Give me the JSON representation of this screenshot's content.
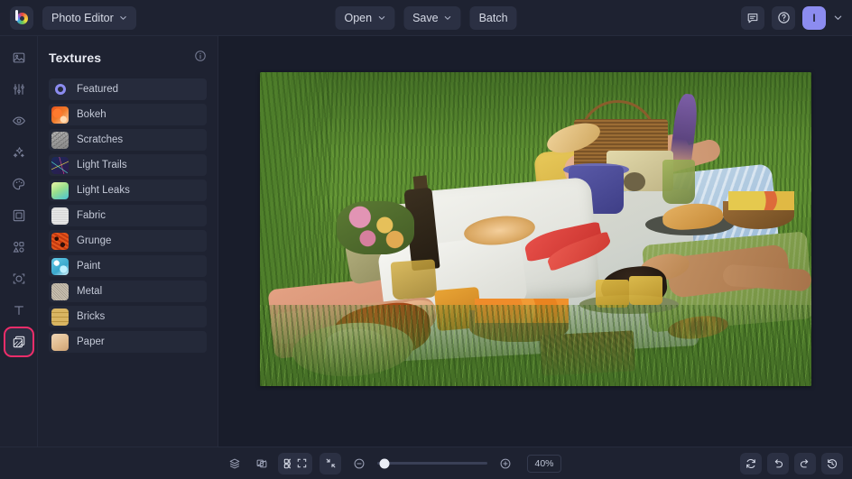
{
  "app": {
    "logo_icon": "pixlr-logo-icon",
    "project_menu": "Photo Editor",
    "project_menu_chevron": "chevron-down-icon"
  },
  "topbar": {
    "open_label": "Open",
    "save_label": "Save",
    "batch_label": "Batch",
    "open_chevron": "chevron-down-icon",
    "save_chevron": "chevron-down-icon",
    "feedback_icon": "comment-icon",
    "help_icon": "question-circle-icon",
    "avatar_initial": "I",
    "avatar_chevron": "chevron-down-icon",
    "avatar_color": "#8c8cf0"
  },
  "toolrail": {
    "items": [
      {
        "name": "tool-image",
        "icon": "image-icon",
        "active": false
      },
      {
        "name": "tool-adjust",
        "icon": "sliders-icon",
        "active": false
      },
      {
        "name": "tool-retouch",
        "icon": "eye-icon",
        "active": false
      },
      {
        "name": "tool-effects",
        "icon": "sparkles-icon",
        "active": false
      },
      {
        "name": "tool-color",
        "icon": "palette-icon",
        "active": false
      },
      {
        "name": "tool-frame",
        "icon": "frame-icon",
        "active": false
      },
      {
        "name": "tool-elements",
        "icon": "shapes-icon",
        "active": false
      },
      {
        "name": "tool-cutout",
        "icon": "cutout-icon",
        "active": false
      },
      {
        "name": "tool-text",
        "icon": "text-t-icon",
        "active": false
      },
      {
        "name": "tool-textures",
        "icon": "layers-stack-icon",
        "active": true
      }
    ],
    "active_highlight_color": "#ef2d6a"
  },
  "panel": {
    "title": "Textures",
    "info_icon": "info-circle-icon",
    "items": [
      {
        "label": "Featured",
        "thumb": "t-featured",
        "selected": true
      },
      {
        "label": "Bokeh",
        "thumb": "t-bokeh",
        "selected": false
      },
      {
        "label": "Scratches",
        "thumb": "t-scratches",
        "selected": false
      },
      {
        "label": "Light Trails",
        "thumb": "t-lighttrails",
        "selected": false
      },
      {
        "label": "Light Leaks",
        "thumb": "t-lightleaks",
        "selected": false
      },
      {
        "label": "Fabric",
        "thumb": "t-fabric",
        "selected": false
      },
      {
        "label": "Grunge",
        "thumb": "t-grunge",
        "selected": false
      },
      {
        "label": "Paint",
        "thumb": "t-paint",
        "selected": false
      },
      {
        "label": "Metal",
        "thumb": "t-metal",
        "selected": false
      },
      {
        "label": "Bricks",
        "thumb": "t-bricks",
        "selected": false
      },
      {
        "label": "Paper",
        "thumb": "t-paper",
        "selected": false
      }
    ]
  },
  "canvas": {
    "image_alt": "Two people lying on a picnic blanket in sunlit grass with a basket, bread, fruit, drinks and flowers"
  },
  "bottombar": {
    "layers_icon": "layers-icon",
    "compare_icon": "compare-icon",
    "grid_icon": "grid-icon",
    "fit_icon": "expand-icon",
    "actual_icon": "fit-screen-icon",
    "zoom_out_icon": "minus-circle-icon",
    "zoom_in_icon": "plus-circle-icon",
    "zoom_value": "40%",
    "reset_icon": "reset-icon",
    "undo_icon": "undo-icon",
    "redo_icon": "redo-icon",
    "history_icon": "history-icon"
  }
}
